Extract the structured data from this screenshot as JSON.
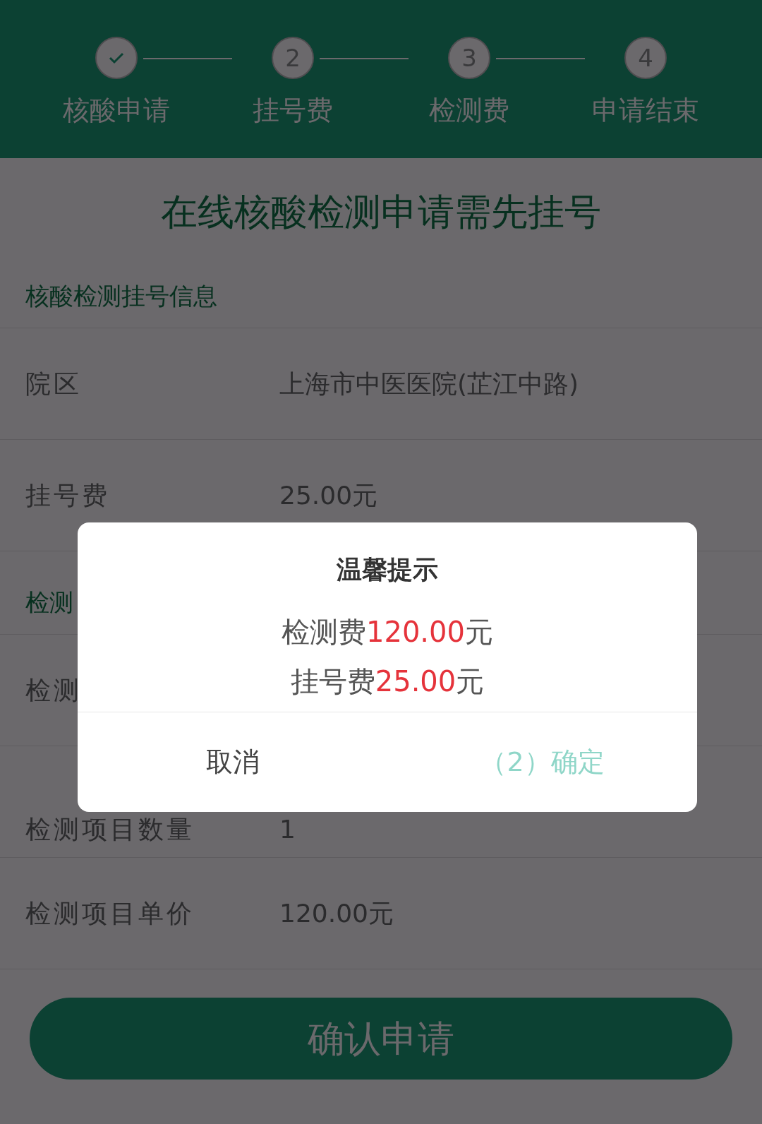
{
  "steps": [
    {
      "label": "核酸申请",
      "done": true
    },
    {
      "label": "挂号费",
      "number": "2",
      "done": false
    },
    {
      "label": "检测费",
      "number": "3",
      "done": false
    },
    {
      "label": "申请结束",
      "number": "4",
      "done": false
    }
  ],
  "headline": "在线核酸检测申请需先挂号",
  "sections": [
    {
      "title": "核酸检测挂号信息",
      "rows": [
        {
          "label": "院区",
          "value": "上海市中医医院(芷江中路)"
        },
        {
          "label": "挂号费",
          "value": "25.00元"
        }
      ]
    },
    {
      "title": "检测",
      "rows": [
        {
          "label": "检测"
        },
        {
          "label": "检测项目数量",
          "value": "1"
        },
        {
          "label": "检测项目单价",
          "value": "120.00元"
        }
      ]
    }
  ],
  "submit_button": "确认申请",
  "dialog": {
    "title": "温馨提示",
    "lines": [
      {
        "text": "检测费",
        "amount": "120.00",
        "unit": "元"
      },
      {
        "text": "挂号费",
        "amount": "25.00",
        "unit": "元"
      }
    ],
    "cancel": "取消",
    "confirm": "（2）确定"
  }
}
